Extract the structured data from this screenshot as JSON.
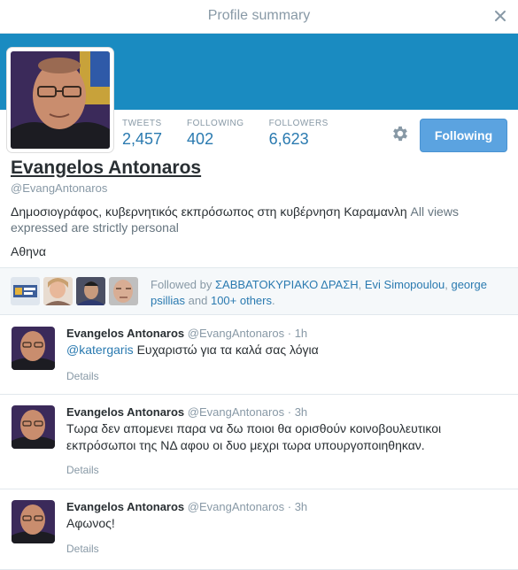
{
  "modal": {
    "title": "Profile summary"
  },
  "profile": {
    "name": "Evangelos Antonaros",
    "handle": "@EvangAntonaros",
    "bio_greek": "Δημοσιογράφος, κυβερνητικός εκπρόσωπος στη κυβέρνηση Καραμανλη",
    "bio_english": "All views expressed are strictly personal",
    "location": "Αθηνα",
    "follow_button_label": "Following"
  },
  "stats": [
    {
      "label": "TWEETS",
      "value": "2,457"
    },
    {
      "label": "FOLLOWING",
      "value": "402"
    },
    {
      "label": "FOLLOWERS",
      "value": "6,623"
    }
  ],
  "followed_by": {
    "prefix": "Followed by",
    "names": [
      "ΣΑΒΒΑΤΟΚΥΡΙΑΚΟ ΔΡΑΣΗ",
      "Evi Simopoulou",
      "george psillias"
    ],
    "separator_1": ",",
    "separator_2": ",",
    "connector": "and",
    "others": "100+ others",
    "end": "."
  },
  "tweets": [
    {
      "name": "Evangelos Antonaros",
      "handle": "@EvangAntonaros",
      "time": "1h",
      "mention": "@katergaris",
      "text": "Ευχαριστώ για τα καλά σας λόγια",
      "details": "Details"
    },
    {
      "name": "Evangelos Antonaros",
      "handle": "@EvangAntonaros",
      "time": "3h",
      "text": "Τωρα δεν απομενει παρα να δω ποιοι θα ορισθούν κοινοβουλευτικοι εκπρόσωποι της ΝΔ αφου οι δυο μεχρι τωρα υπουργοποιηθηκαν.",
      "details": "Details"
    },
    {
      "name": "Evangelos Antonaros",
      "handle": "@EvangAntonaros",
      "time": "3h",
      "text": "Αφωνος!",
      "details": "Details"
    }
  ],
  "colors": {
    "cover": "#1a8bc1",
    "link": "#2a7ab0",
    "button": "#5ba3e0",
    "muted": "#8899a6"
  },
  "icons": {
    "close": "close-icon",
    "settings": "gear-icon"
  }
}
